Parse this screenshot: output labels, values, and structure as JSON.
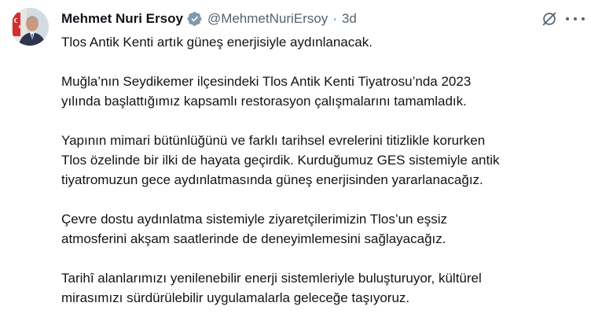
{
  "author": {
    "name": "Mehmet Nuri Ersoy",
    "handle": "@MehmetNuriErsoy",
    "separator": "·",
    "time": "3d"
  },
  "icons": {
    "verified": "verified-badge-icon",
    "grok": "grok-icon",
    "more": "more-options-icon"
  },
  "colors": {
    "verified": "#e8a300",
    "secondary_text": "#536471",
    "text": "#0f1419"
  },
  "tweet": {
    "paragraphs": [
      [
        "Tlos Antik Kenti artık güneş enerjisiyle aydınlanacak."
      ],
      [
        "Muğla’nın Seydikemer ilçesindeki Tlos Antik Kenti Tiyatrosu’nda 2023",
        "yılında başlattığımız kapsamlı restorasyon çalışmalarını tamamladık."
      ],
      [
        "Yapının mimari bütünlüğünü ve farklı tarihsel evrelerini titizlikle korurken",
        "Tlos özelinde bir ilki de hayata geçirdik. Kurduğumuz GES sistemiyle antik",
        "tiyatromuzun gece aydınlatmasında güneş enerjisinden yararlanacağız."
      ],
      [
        "Çevre dostu aydınlatma sistemiyle ziyaretçilerimizin Tlos’un eşsiz",
        "atmosferini akşam saatlerinde de deneyimlemesini sağlayacağız."
      ],
      [
        "Tarihî alanlarımızı yenilenebilir enerji sistemleriyle buluşturuyor, kültürel",
        "mirasımızı sürdürülebilir uygulamalarla geleceğe taşıyoruz."
      ]
    ]
  }
}
